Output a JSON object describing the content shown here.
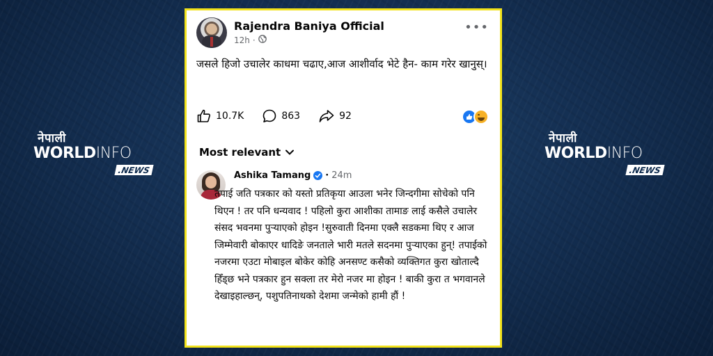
{
  "watermark": {
    "nepali": "नेपाली",
    "world": "WORLD",
    "info": "INFO",
    "news": ".NEWS"
  },
  "post": {
    "author": "Rajendra Baniya Official",
    "time": "12h",
    "privacy_icon": "globe-icon",
    "text": "जसले हिजो उचालेर काधमा चढाए,आज आशीर्वाद भेटे हैन- काम गरेर खानुस्।",
    "likes": "10.7K",
    "comments": "863",
    "shares": "92",
    "reaction_icons": [
      "like-icon",
      "haha-icon"
    ]
  },
  "comments_section": {
    "sort_label": "Most relevant"
  },
  "comment": {
    "author": "Ashika Tamang",
    "time": "24m",
    "text": "तपाई जति पत्रकार को यस्तो प्रतिकृया आउला भनेर जिन्दगीमा सोचेको पनि थिएन ! तर पनि धन्यवाद ! पहिलो कुरा आशीका तामाङ लाई कसैले उचालेर संसद भवनमा पुऱ्याएको होइन !सुरुवाती दिनमा एक्लै सडकमा थिए र आज जिम्मेवारी बोकाएर धादिङे जनताले भारी मतले सदनमा पुऱ्याएका हुन्! तपाईको नजरमा एउटा मोबाइल बोकेर कोहि अनसण्ट कसैको व्यक्तिगत कुरा खोताल्दै हिँड्छ भने पत्रकार हुन सक्ला तर मेरो नजर मा होइन ! बाकी कुरा त भगवानले देखाइहाल्छन्, पशुपतिनाथको देशमा जन्मेको हामी हौं !"
  },
  "colors": {
    "card_border": "#f2e21a",
    "background": "#142f52",
    "brand_blue": "#1877f2"
  }
}
